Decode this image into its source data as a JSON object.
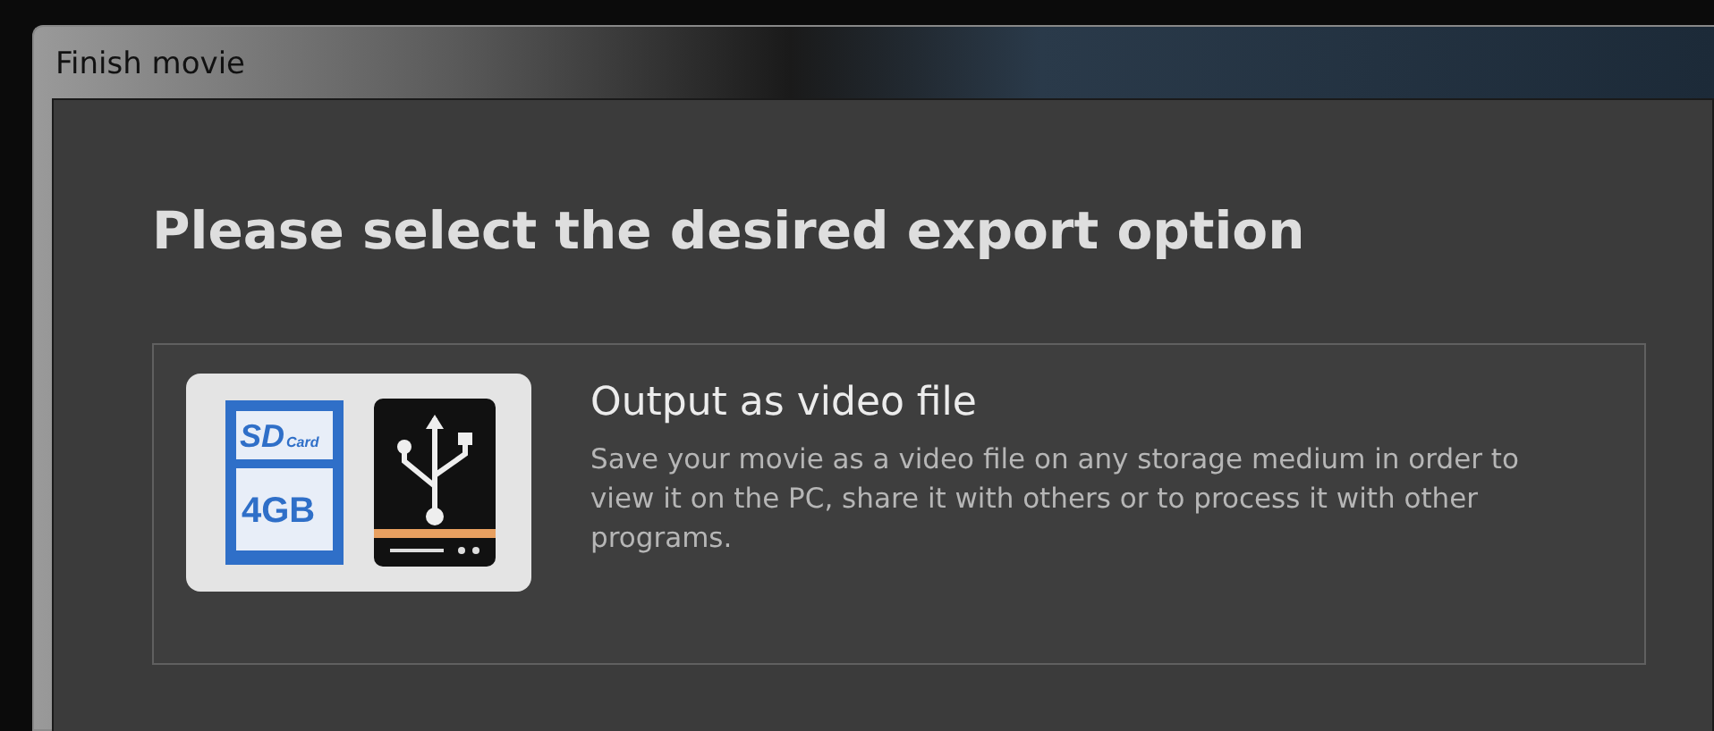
{
  "window": {
    "title": "Finish movie"
  },
  "heading": "Please select the desired export option",
  "options": [
    {
      "title": "Output as video file",
      "description": "Save your movie as a video file on any storage medium in order to view it on the PC, share it with others or to process it with other programs.",
      "icon": {
        "card_brand": "SD",
        "card_type": "Card",
        "capacity": "4GB"
      }
    }
  ]
}
